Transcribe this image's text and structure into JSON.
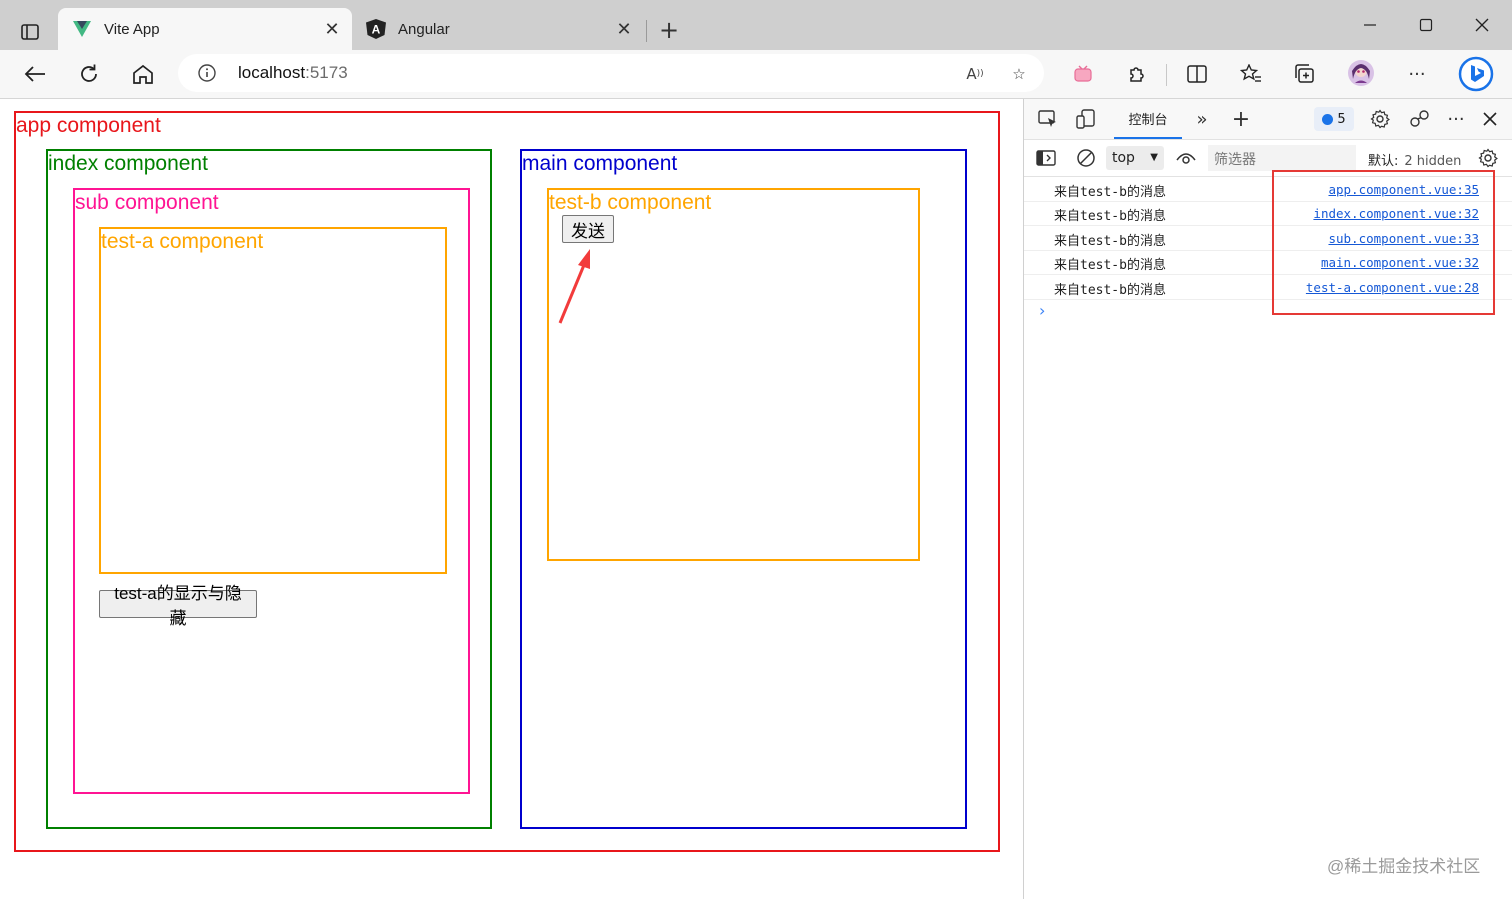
{
  "browser": {
    "tabs": [
      {
        "title": "Vite App",
        "active": true,
        "favicon": "vite-logo-icon"
      },
      {
        "title": "Angular",
        "active": false,
        "favicon": "angular-logo-icon"
      }
    ],
    "new_tab_label": "+",
    "address": {
      "host": "localhost",
      "port": ":5173"
    },
    "window_controls": [
      "minimize",
      "maximize",
      "close"
    ]
  },
  "page": {
    "app_label": "app component",
    "index_label": "index component",
    "sub_label": "sub component",
    "test_a_label": "test-a component",
    "toggle_button": "test-a的显示与隐藏",
    "main_label": "main component",
    "test_b_label": "test-b component",
    "send_button": "发送",
    "colors": {
      "app": "#e8161b",
      "index": "#008000",
      "sub": "#ff1493",
      "test_a": "#ffa500",
      "main": "#0000cd",
      "test_b": "#ffa500",
      "arrow": "#f23b3b"
    }
  },
  "devtools": {
    "active_tab": "控制台",
    "issues_count": "5",
    "context": "top",
    "filter_placeholder": "筛选器",
    "levels_label": "默认",
    "hidden_count": "2 hidden",
    "console_messages": [
      {
        "text": "来自test-b的消息",
        "source": "app.component.vue:35"
      },
      {
        "text": "来自test-b的消息",
        "source": "index.component.vue:32"
      },
      {
        "text": "来自test-b的消息",
        "source": "sub.component.vue:33"
      },
      {
        "text": "来自test-b的消息",
        "source": "main.component.vue:32"
      },
      {
        "text": "来自test-b的消息",
        "source": "test-a.component.vue:28"
      }
    ],
    "prompt_symbol": "›"
  },
  "watermark": "@稀土掘金技术社区"
}
